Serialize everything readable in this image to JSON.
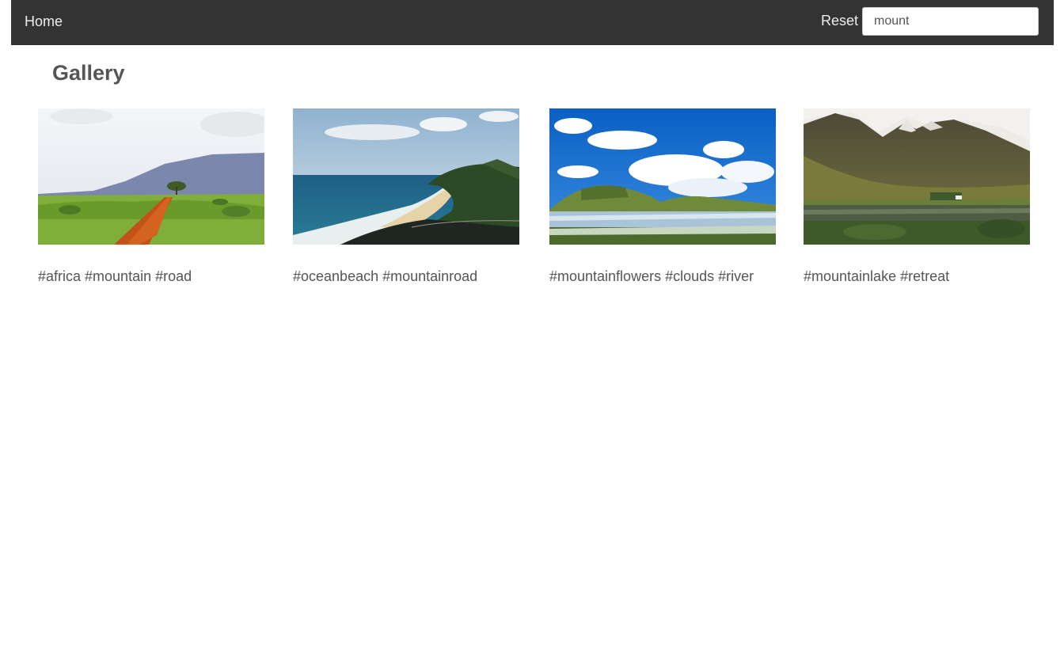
{
  "navbar": {
    "home_label": "Home",
    "reset_label": "Reset",
    "search_value": "mount"
  },
  "page": {
    "title": "Gallery"
  },
  "gallery": {
    "items": [
      {
        "caption": "#africa #mountain #road",
        "image_icon": "landscape-photo-africa-road"
      },
      {
        "caption": "#oceanbeach #mountainroad",
        "image_icon": "landscape-photo-ocean-beach"
      },
      {
        "caption": "#mountainflowers #clouds #river",
        "image_icon": "landscape-photo-mountain-river"
      },
      {
        "caption": "#mountainlake #retreat",
        "image_icon": "landscape-photo-mountain-lake"
      }
    ]
  },
  "colors": {
    "navbar_bg": "#333333",
    "nav_text": "#eeeeee",
    "body_text": "#555555"
  }
}
